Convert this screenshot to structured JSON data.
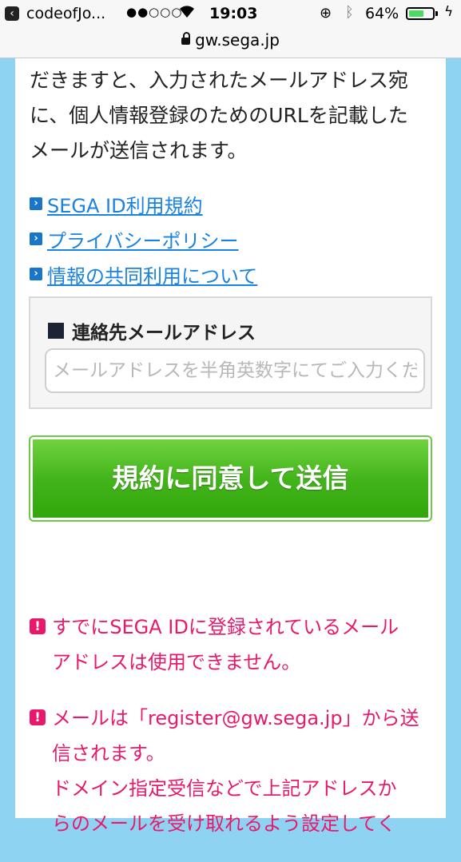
{
  "status_bar": {
    "carrier": "codeofJo...",
    "signal": "●●○○○",
    "time": "19:03",
    "battery_percent": "64%",
    "battery_level": 0.64
  },
  "url_bar": {
    "url": "gw.sega.jp"
  },
  "intro": {
    "text": "だきますと、入力されたメールアドレス宛\nに、個人情報登録のためのURLを記載した\nメールが送信されます。"
  },
  "links": [
    {
      "label": "SEGA ID利用規約"
    },
    {
      "label": "プライバシーポリシー"
    },
    {
      "label": "情報の共同利用について"
    }
  ],
  "email_form": {
    "label": "連絡先メールアドレス",
    "placeholder": "メールアドレスを半角英数字にてご入力ください",
    "value": ""
  },
  "submit_button": {
    "label": "規約に同意して送信"
  },
  "notices": [
    {
      "text": "すでにSEGA IDに登録されているメール\nアドレスは使用できません。"
    },
    {
      "text": "メールは「register@gw.sega.jp」から送\n信されます。\nドメイン指定受信などで上記アドレスか\nらのメールを受け取れるよう設定してく"
    }
  ],
  "colors": {
    "page_background": "#8fd3f3",
    "link": "#1a82e2",
    "button_green": "#43b51b",
    "notice_pink": "#e8196b"
  }
}
